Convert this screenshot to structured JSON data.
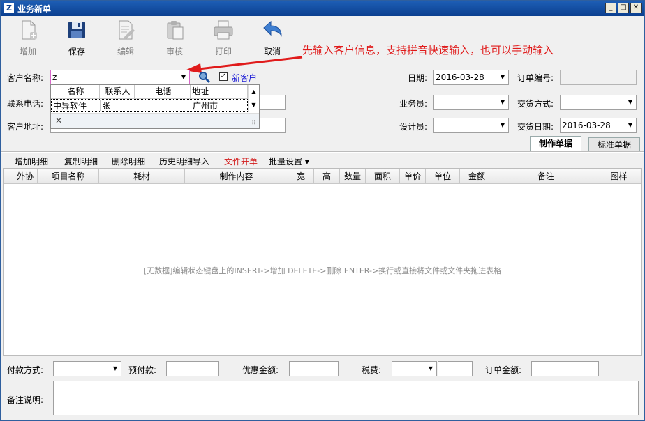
{
  "window": {
    "logo": "Z",
    "title": "业务新单",
    "min": "_",
    "max": "□",
    "close": "✕"
  },
  "toolbar": {
    "buttons": [
      {
        "label": "增加",
        "icon": "add-document-icon",
        "enabled": false
      },
      {
        "label": "保存",
        "icon": "save-disk-icon",
        "enabled": true
      },
      {
        "label": "编辑",
        "icon": "edit-document-icon",
        "enabled": false
      },
      {
        "label": "审核",
        "icon": "clipboard-icon",
        "enabled": false
      },
      {
        "label": "打印",
        "icon": "printer-icon",
        "enabled": false
      },
      {
        "label": "取消",
        "icon": "undo-arrow-icon",
        "enabled": true
      }
    ]
  },
  "annotation": "先输入客户信息，支持拼音快速输入，也可以手动输入",
  "form": {
    "customer_name_label": "客户名称:",
    "customer_name_value": "z",
    "new_customer_label": "新客户",
    "new_customer_checked": "✓",
    "phone_label": "联系电话:",
    "address_label": "客户地址:",
    "date_label": "日期:",
    "date_value": "2016-03-28",
    "order_no_label": "订单编号:",
    "salesman_label": "业务员:",
    "delivery_method_label": "交货方式:",
    "designer_label": "设计员:",
    "delivery_date_label": "交货日期:",
    "delivery_date_value": "2016-03-28"
  },
  "popup": {
    "columns": [
      "名称",
      "联系人",
      "电话",
      "地址"
    ],
    "rows": [
      {
        "name": "中异软件",
        "contact": "张",
        "phone": "",
        "address": "广州市"
      }
    ],
    "close": "✕",
    "grip": "⠿"
  },
  "tabs": [
    "制作单据",
    "标准单据"
  ],
  "grid_toolbar": [
    "增加明细",
    "复制明细",
    "删除明细",
    "历史明细导入",
    "文件开单",
    "批量设置 ▾"
  ],
  "grid": {
    "columns": [
      "",
      "外协",
      "项目名称",
      "耗材",
      "制作内容",
      "宽",
      "高",
      "数量",
      "面积",
      "单价",
      "单位",
      "金额",
      "备注",
      "图样"
    ],
    "empty_text": "[无数据]编辑状态键盘上的INSERT->增加 DELETE->删除 ENTER->换行或直接将文件或文件夹拖进表格"
  },
  "footer": {
    "payment_label": "付款方式:",
    "prepay_label": "预付款:",
    "discount_label": "优惠金额:",
    "tax_label": "税费:",
    "order_amount_label": "订单金额:",
    "remark_label": "备注说明:"
  },
  "colors": {
    "accent_red": "#e01b1b",
    "titlebar": "#0b3f8f"
  }
}
